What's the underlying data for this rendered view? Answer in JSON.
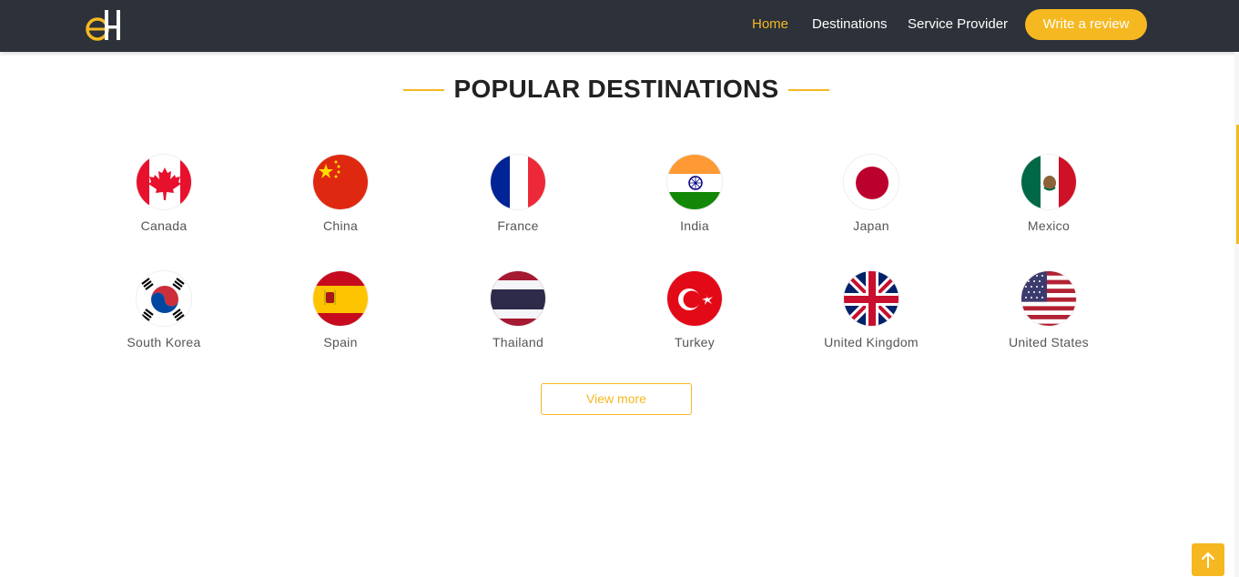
{
  "nav": {
    "links": [
      "Home",
      "Destinations",
      "Service Provider"
    ],
    "active_link": "Home",
    "review_button": "Write a review"
  },
  "section": {
    "title": "POPULAR DESTINATIONS",
    "view_more": "View more"
  },
  "destinations": [
    {
      "name": "Canada",
      "flag_icon": "canada-flag-icon"
    },
    {
      "name": "China",
      "flag_icon": "china-flag-icon"
    },
    {
      "name": "France",
      "flag_icon": "france-flag-icon"
    },
    {
      "name": "India",
      "flag_icon": "india-flag-icon"
    },
    {
      "name": "Japan",
      "flag_icon": "japan-flag-icon"
    },
    {
      "name": "Mexico",
      "flag_icon": "mexico-flag-icon"
    },
    {
      "name": "South Korea",
      "flag_icon": "south-korea-flag-icon"
    },
    {
      "name": "Spain",
      "flag_icon": "spain-flag-icon"
    },
    {
      "name": "Thailand",
      "flag_icon": "thailand-flag-icon"
    },
    {
      "name": "Turkey",
      "flag_icon": "turkey-flag-icon"
    },
    {
      "name": "United Kingdom",
      "flag_icon": "united-kingdom-flag-icon"
    },
    {
      "name": "United States",
      "flag_icon": "united-states-flag-icon"
    }
  ],
  "colors": {
    "accent": "#f5b820",
    "navbar": "#2c313a"
  }
}
